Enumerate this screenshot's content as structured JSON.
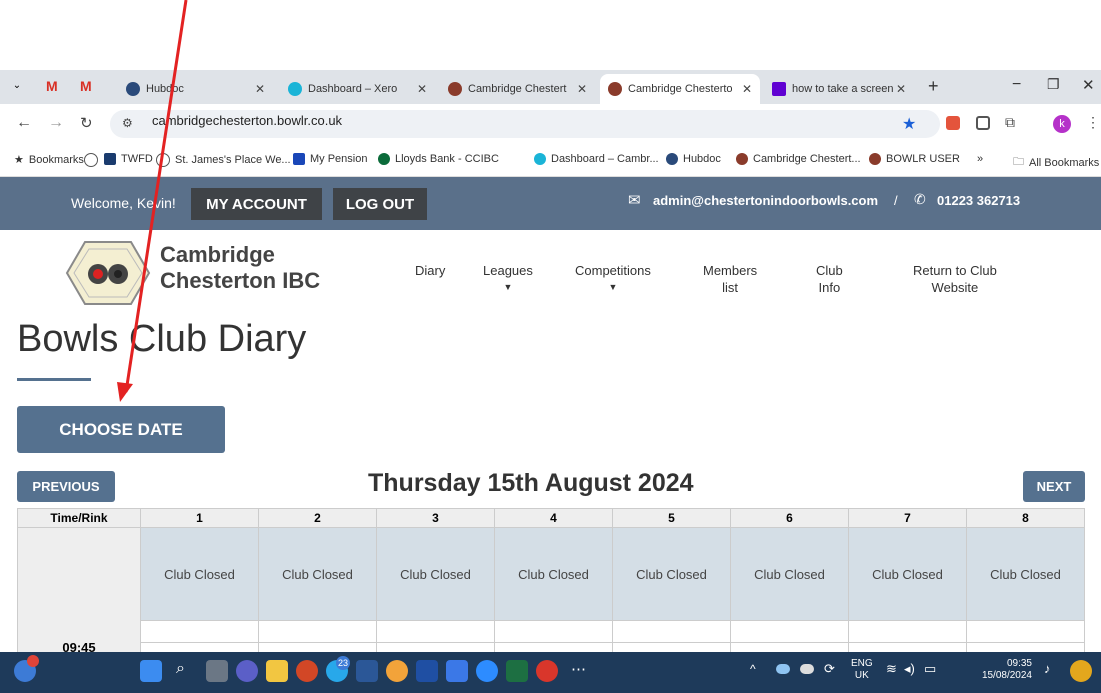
{
  "browser": {
    "tabs": [
      {
        "label": "Hubdoc",
        "active": false
      },
      {
        "label": "Dashboard – Xero",
        "active": false
      },
      {
        "label": "Cambridge Chestert",
        "active": false
      },
      {
        "label": "Cambridge Chesterto",
        "active": true
      },
      {
        "label": "how to take a screen",
        "active": false
      }
    ],
    "url": "cambridgechesterton.bowlr.co.uk",
    "profile_initial": "k",
    "bookmarks": [
      "Bookmarks",
      "TWFD",
      "St. James's Place We...",
      "My Pension",
      "Lloyds Bank - CCIBC",
      "Dashboard – Cambr...",
      "Hubdoc",
      "Cambridge Chestert...",
      "BOWLR USER",
      "»",
      "All Bookmarks"
    ]
  },
  "site": {
    "welcome": "Welcome, Kevin!",
    "my_account": "MY ACCOUNT",
    "log_out": "LOG OUT",
    "email": "admin@chestertonindoorbowls.com",
    "separator": "/",
    "phone": "01223 362713",
    "club_name_line1": "Cambridge",
    "club_name_line2": "Chesterton IBC",
    "nav": {
      "diary": "Diary",
      "leagues": "Leagues",
      "competitions": "Competitions",
      "members_line1": "Members",
      "members_line2": "list",
      "club_line1": "Club",
      "club_line2": "Info",
      "return_line1": "Return to Club",
      "return_line2": "Website"
    }
  },
  "diary": {
    "page_title": "Bowls Club Diary",
    "choose_date": "CHOOSE DATE",
    "previous": "PREVIOUS",
    "next": "NEXT",
    "date_heading": "Thursday 15th August 2024",
    "header_time": "Time/Rink",
    "rinks": [
      "1",
      "2",
      "3",
      "4",
      "5",
      "6",
      "7",
      "8"
    ],
    "cell_text": "Club Closed",
    "time_label": "09:45"
  },
  "taskbar": {
    "lang_line1": "ENG",
    "lang_line2": "UK",
    "time": "09:35",
    "date": "15/08/2024",
    "teams_badge": "23"
  },
  "colors": {
    "site_header": "#5a708a",
    "button_blue": "#55718f",
    "cell_closed": "#d4dee6",
    "arrow": "#e32222"
  }
}
